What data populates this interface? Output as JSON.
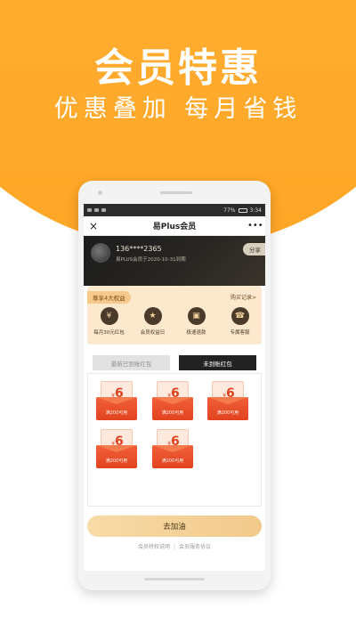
{
  "promo": {
    "title": "会员特惠",
    "subtitle": "优惠叠加 每月省钱"
  },
  "status_bar": {
    "left": "▪▪ ▪▪ ☰",
    "battery": "77%",
    "time": "3:34"
  },
  "nav": {
    "close_icon": "×",
    "title": "易Plus会员",
    "more_icon": "•••"
  },
  "member": {
    "phone": "136****2365",
    "expiry": "易PLUS会员于2020-10-31到期",
    "share_label": "分享"
  },
  "benefits": {
    "tag": "尊享4大权益",
    "buy_record": "购买记录>",
    "items": [
      {
        "label": "每月30元红包",
        "icon": "coupon-icon",
        "glyph": "¥"
      },
      {
        "label": "会员权益日",
        "icon": "vip-day-icon",
        "glyph": "★"
      },
      {
        "label": "极速退款",
        "icon": "wallet-icon",
        "glyph": "▣"
      },
      {
        "label": "专属客服",
        "icon": "headset-icon",
        "glyph": "☎"
      }
    ]
  },
  "tabs": [
    {
      "label": "最新已到账红包",
      "active": false
    },
    {
      "label": "未到账红包",
      "active": true
    }
  ],
  "coupons": [
    {
      "currency": "¥",
      "amount": "6",
      "condition": "满200可用"
    },
    {
      "currency": "¥",
      "amount": "6",
      "condition": "满200可用"
    },
    {
      "currency": "¥",
      "amount": "6",
      "condition": "满200可用"
    },
    {
      "currency": "¥",
      "amount": "6",
      "condition": "满200可用"
    },
    {
      "currency": "¥",
      "amount": "6",
      "condition": "满200可用"
    }
  ],
  "cta": {
    "label": "去加油"
  },
  "footer": {
    "link1": "会员特权说明",
    "separator": "|",
    "link2": "会员服务协议"
  },
  "colors": {
    "brand_orange": "#ffa626",
    "gold": "#f1c98b",
    "coupon_red": "#e2431f"
  }
}
